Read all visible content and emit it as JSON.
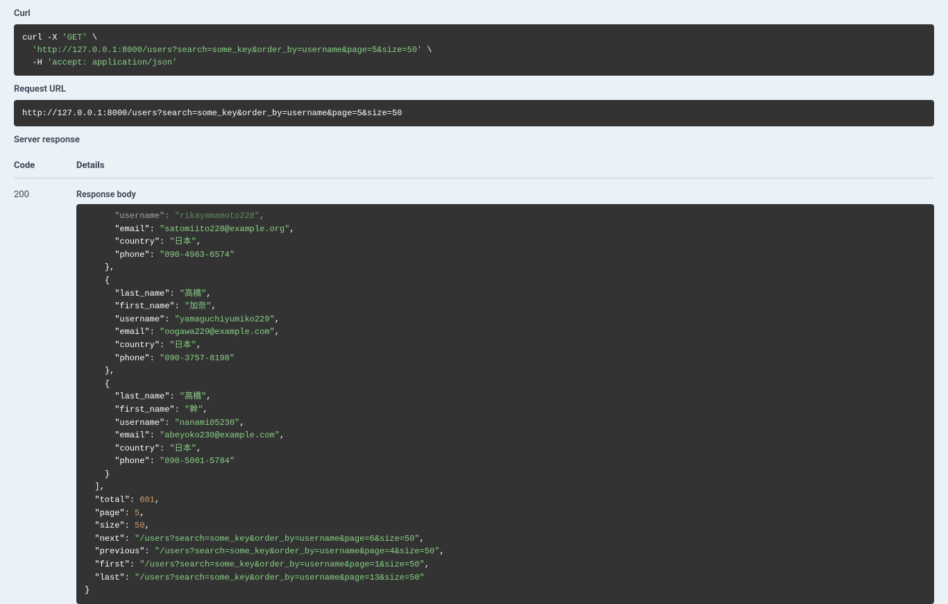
{
  "sections": {
    "curl_label": "Curl",
    "request_url_label": "Request URL",
    "server_response_label": "Server response",
    "code_header": "Code",
    "details_header": "Details",
    "response_body_label": "Response body"
  },
  "curl": {
    "line1_cmd": "curl -X ",
    "line1_method": "'GET'",
    "line1_cont": " \\",
    "line2_url": "  'http://127.0.0.1:8000/users?search=some_key&order_by=username&page=5&size=50'",
    "line2_cont": " \\",
    "line3_flag": "  -H ",
    "line3_header": "'accept: application/json'"
  },
  "request_url": "http://127.0.0.1:8000/users?search=some_key&order_by=username&page=5&size=50",
  "response": {
    "code": "200",
    "body": {
      "partial_top": {
        "username_key": "username",
        "username_val": "rikayamamoto228",
        "email_key": "email",
        "email_val": "satomiito228@example.org",
        "country_key": "country",
        "country_val": "日本",
        "phone_key": "phone",
        "phone_val": "090-4963-6574"
      },
      "items": [
        {
          "last_name": "高橋",
          "first_name": "加奈",
          "username": "yamaguchiyumiko229",
          "email": "oogawa229@example.com",
          "country": "日本",
          "phone": "090-3757-8198"
        },
        {
          "last_name": "高橋",
          "first_name": "幹",
          "username": "nanami05230",
          "email": "abeyoko230@example.com",
          "country": "日本",
          "phone": "090-5001-5784"
        }
      ],
      "total": 601,
      "page": 5,
      "size": 50,
      "next": "/users?search=some_key&order_by=username&page=6&size=50",
      "previous": "/users?search=some_key&order_by=username&page=4&size=50",
      "first": "/users?search=some_key&order_by=username&page=1&size=50",
      "last": "/users?search=some_key&order_by=username&page=13&size=50"
    }
  }
}
